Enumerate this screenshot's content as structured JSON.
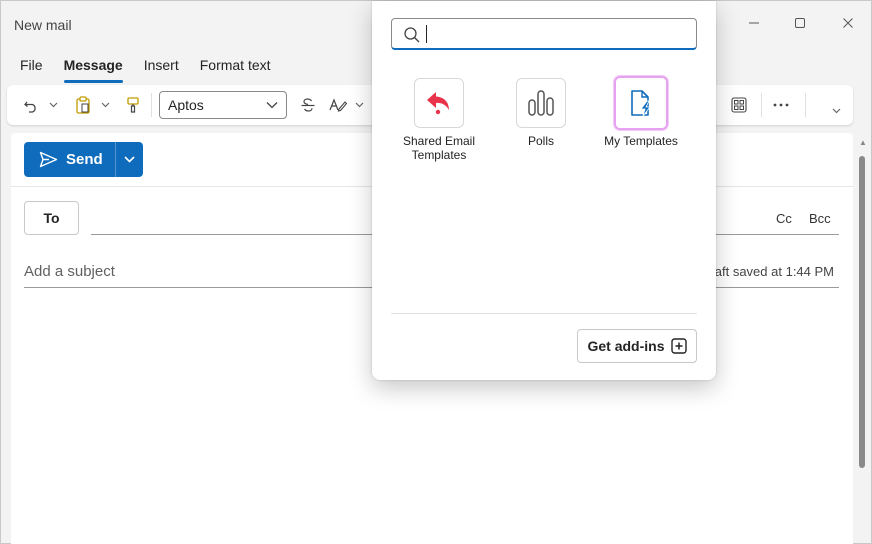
{
  "window": {
    "title": "New mail"
  },
  "tabs": [
    {
      "label": "File"
    },
    {
      "label": "Message",
      "active": true
    },
    {
      "label": "Insert"
    },
    {
      "label": "Format text"
    }
  ],
  "ribbon": {
    "font_name": "Aptos"
  },
  "compose": {
    "send_label": "Send",
    "to_label": "To",
    "cc_label": "Cc",
    "bcc_label": "Bcc",
    "subject_placeholder": "Add a subject",
    "draft_status": "Draft saved at 1:44 PM"
  },
  "addins_popup": {
    "search_value": "",
    "items": [
      {
        "label": "Shared Email Templates",
        "icon": "shared-email-templates-icon"
      },
      {
        "label": "Polls",
        "icon": "polls-icon"
      },
      {
        "label": "My Templates",
        "icon": "my-templates-icon",
        "selected": true
      }
    ],
    "get_addins_label": "Get add-ins"
  },
  "colors": {
    "accent": "#0f6cbd",
    "shared_templates_icon": "#e8334a",
    "selection_outline": "#e6a1f0"
  }
}
